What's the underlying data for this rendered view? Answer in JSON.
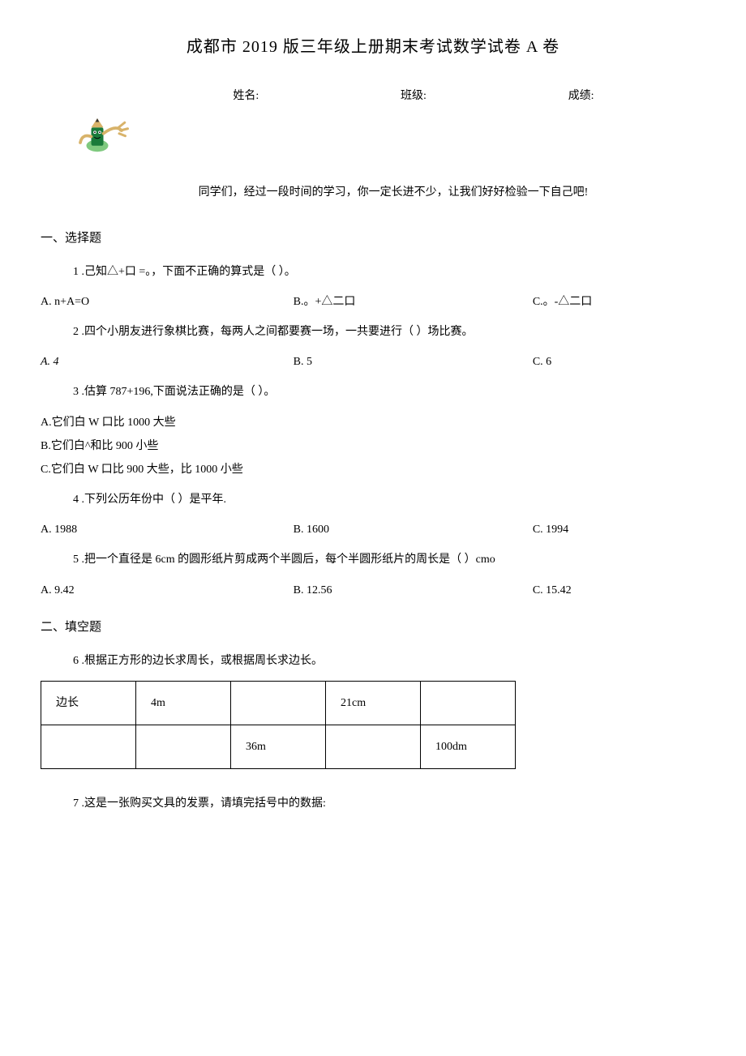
{
  "title": "成都市 2019 版三年级上册期末考试数学试卷  A 卷",
  "fields": {
    "name_label": "姓名:",
    "class_label": "班级:",
    "score_label": "成绩:"
  },
  "intro": "同学们，经过一段时间的学习，你一定长进不少，让我们好好检验一下自己吧!",
  "section1": {
    "heading": "一、选择题",
    "q1": {
      "stem": "1 .己知△+口  =。，下面不正确的算式是（                ）。",
      "A": "A. n+A=O",
      "B": "B.。+△二口",
      "C": "C.。-△二口"
    },
    "q2": {
      "stem": "2 .四个小朋友进行象棋比赛，每两人之间都要赛一场，一共要进行（                     ）场比赛。",
      "A": "A. 4",
      "B": "B. 5",
      "C": "C. 6"
    },
    "q3": {
      "stem": "3 .估算 787+196,下面说法正确的是（                ）。",
      "A": "A.它们白 W 口比 1000 大些",
      "B": "B.它们白^和比 900 小些",
      "C": "C.它们白 W 口比  900 大些，比 1000 小些"
    },
    "q4": {
      "stem": "4 .下列公历年份中（           ）是平年.",
      "A": "A. 1988",
      "B": "B. 1600",
      "C": "C. 1994"
    },
    "q5": {
      "stem": "5 .把一个直径是 6cm 的圆形纸片剪成两个半圆后，每个半圆形纸片的周长是（                    ）cmo",
      "A": "A. 9.42",
      "B": "B. 12.56",
      "C": "C. 15.42"
    }
  },
  "section2": {
    "heading": "二、填空题",
    "q6": {
      "stem": "6 .根据正方形的边长求周长，或根据周长求边长。",
      "table": {
        "r1c1": "边长",
        "r1c2": "4m",
        "r1c3": "",
        "r1c4": "21cm",
        "r1c5": "",
        "r2c1": "",
        "r2c2": "",
        "r2c3": "36m",
        "r2c4": "",
        "r2c5": "100dm"
      }
    },
    "q7": {
      "stem": "7 .这是一张购买文具的发票，请填完括号中的数据:"
    }
  }
}
